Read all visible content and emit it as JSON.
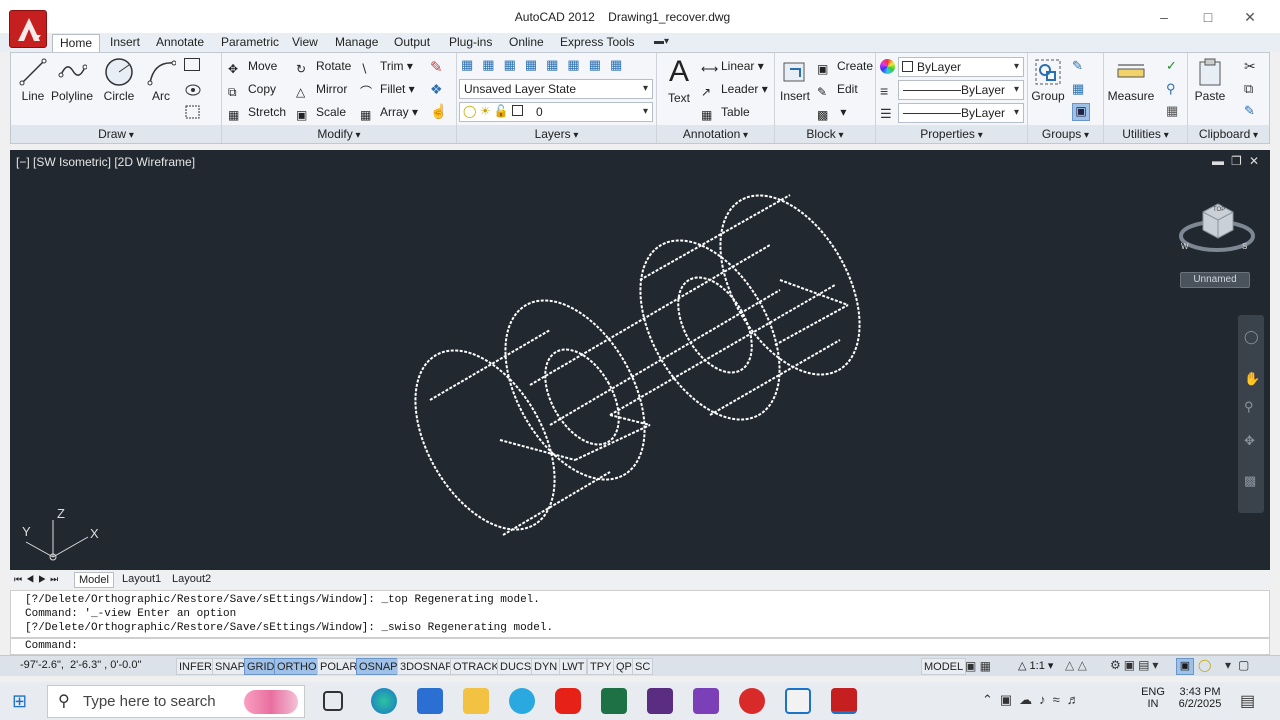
{
  "window": {
    "title": "AutoCAD 2012    Drawing1_recover.dwg"
  },
  "tabs": [
    "Home",
    "Insert",
    "Annotate",
    "Parametric",
    "View",
    "Manage",
    "Output",
    "Plug-ins",
    "Online",
    "Express Tools"
  ],
  "draw": {
    "line": "Line",
    "polyline": "Polyline",
    "circle": "Circle",
    "arc": "Arc",
    "panel": "Draw"
  },
  "modify": {
    "move": "Move",
    "rotate": "Rotate",
    "trim": "Trim",
    "copy": "Copy",
    "mirror": "Mirror",
    "fillet": "Fillet",
    "stretch": "Stretch",
    "scale": "Scale",
    "array": "Array",
    "panel": "Modify"
  },
  "layers": {
    "state": "Unsaved Layer State",
    "current": "0",
    "panel": "Layers"
  },
  "annotation": {
    "text": "Text",
    "linear": "Linear",
    "leader": "Leader",
    "table": "Table",
    "panel": "Annotation"
  },
  "block": {
    "insert": "Insert",
    "create": "Create",
    "edit": "Edit",
    "panel": "Block"
  },
  "properties": {
    "color": "ByLayer",
    "lineweight": "ByLayer",
    "linetype": "ByLayer",
    "panel": "Properties"
  },
  "groups": {
    "group": "Group",
    "panel": "Groups"
  },
  "utilities": {
    "measure": "Measure",
    "panel": "Utilities"
  },
  "clipboard": {
    "paste": "Paste",
    "panel": "Clipboard"
  },
  "viewport": {
    "label": "[−] [SW Isometric] [2D Wireframe]",
    "viewcube_label": "Unnamed",
    "ucs_x": "X",
    "ucs_y": "Y",
    "ucs_z": "Z",
    "cube_top": "TOP",
    "cube_compass": "W",
    "cube_compass2": "S"
  },
  "layout_tabs": [
    "Model",
    "Layout1",
    "Layout2"
  ],
  "command": {
    "history": [
      "[?/Delete/Orthographic/Restore/Save/sEttings/Window]: _top Regenerating model.",
      "Command: '_-view Enter an option",
      "[?/Delete/Orthographic/Restore/Save/sEttings/Window]: _swiso Regenerating model."
    ],
    "prompt": "Command:"
  },
  "status": {
    "coords": "-97'-2.6\",  2'-6.3\" , 0'-0.0\"",
    "toggles": [
      {
        "label": "INFER",
        "on": false
      },
      {
        "label": "SNAP",
        "on": false
      },
      {
        "label": "GRID",
        "on": true
      },
      {
        "label": "ORTHO",
        "on": true
      },
      {
        "label": "POLAR",
        "on": false
      },
      {
        "label": "OSNAP",
        "on": true
      },
      {
        "label": "3DOSNAP",
        "on": false
      },
      {
        "label": "OTRACK",
        "on": false
      },
      {
        "label": "DUCS",
        "on": false
      },
      {
        "label": "DYN",
        "on": false
      },
      {
        "label": "LWT",
        "on": false
      },
      {
        "label": "TPY",
        "on": false
      },
      {
        "label": "QP",
        "on": false
      },
      {
        "label": "SC",
        "on": false
      }
    ],
    "space": "MODEL",
    "scale": "1:1"
  },
  "taskbar": {
    "search_placeholder": "Type here to search",
    "time": "3:43 PM",
    "date": "6/2/2025",
    "lang": "ENG",
    "region": "IN"
  },
  "colors": {
    "viewport_bg": "#212830",
    "ribbon_bg": "#f4f6f9",
    "accent": "#c61f1f",
    "toggle_on": "#9fc1e8"
  }
}
